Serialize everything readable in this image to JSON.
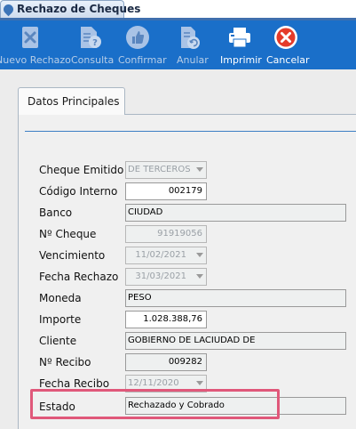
{
  "window": {
    "tab_title": "Rechazo de Cheques"
  },
  "toolbar": {
    "buttons": [
      {
        "label": "Nuevo Rechazo",
        "icon": "cheque-x-icon",
        "enabled": false
      },
      {
        "label": "Consulta",
        "icon": "document-help-icon",
        "enabled": false
      },
      {
        "label": "Confirmar",
        "icon": "thumbs-up-icon",
        "enabled": false
      },
      {
        "label": "Anular",
        "icon": "document-undo-icon",
        "enabled": false
      },
      {
        "label": "Imprimir",
        "icon": "printer-icon",
        "enabled": true
      },
      {
        "label": "Cancelar",
        "icon": "cancel-x-icon",
        "enabled": true
      }
    ]
  },
  "tabs": [
    {
      "label": "Datos Principales",
      "active": true
    }
  ],
  "form": {
    "cheque_emitido": {
      "label": "Cheque Emitido",
      "value": "DE TERCEROS"
    },
    "codigo_interno": {
      "label": "Código Interno",
      "value": "002179"
    },
    "banco": {
      "label": "Banco",
      "value": "CIUDAD"
    },
    "nro_cheque": {
      "label": "Nº Cheque",
      "value": "91919056"
    },
    "vencimiento": {
      "label": "Vencimiento",
      "value": "11/02/2021"
    },
    "fecha_rechazo": {
      "label": "Fecha Rechazo",
      "value": "31/03/2021"
    },
    "moneda": {
      "label": "Moneda",
      "value": "PESO"
    },
    "importe": {
      "label": "Importe",
      "value": "1.028.388,76"
    },
    "cliente": {
      "label": "Cliente",
      "value": "GOBIERNO DE LACIUDAD DE"
    },
    "nro_recibo": {
      "label": "Nº Recibo",
      "value": "009282"
    },
    "fecha_recibo": {
      "label": "Fecha Recibo",
      "value": "12/11/2020"
    },
    "estado": {
      "label": "Estado",
      "value": "Rechazado y Cobrado"
    }
  },
  "colors": {
    "toolbar": "#1a6fc9",
    "highlight": "#e0587a",
    "rule": "#3c7fc4"
  }
}
